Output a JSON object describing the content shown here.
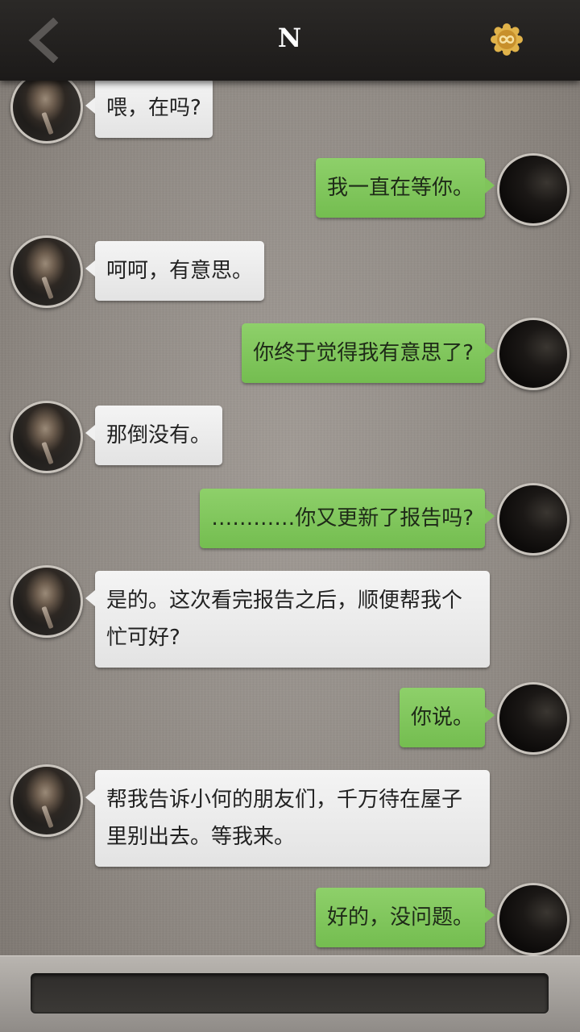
{
  "header": {
    "title": "N",
    "back_icon": "chevron-left-icon",
    "badge_icon": "infinity-badge-icon"
  },
  "messages": [
    {
      "side": "in",
      "text": "喂，在吗?"
    },
    {
      "side": "out",
      "text": "我一直在等你。"
    },
    {
      "side": "in",
      "text": "呵呵，有意思。"
    },
    {
      "side": "out",
      "text": "你终于觉得我有意思了?"
    },
    {
      "side": "in",
      "text": "那倒没有。"
    },
    {
      "side": "out",
      "text": "…………你又更新了报告吗?"
    },
    {
      "side": "in",
      "text": "是的。这次看完报告之后，顺便帮我个忙可好?"
    },
    {
      "side": "out",
      "text": "你说。"
    },
    {
      "side": "in",
      "text": "帮我告诉小何的朋友们，千万待在屋子里别出去。等我来。"
    },
    {
      "side": "out",
      "text": "好的，没问题。"
    }
  ],
  "input": {
    "value": "",
    "placeholder": ""
  },
  "colors": {
    "header_bg": "#1f1d1c",
    "incoming_bubble": "#eeeeee",
    "outgoing_bubble": "#7fc45a",
    "badge_gold": "#d9a83a"
  }
}
